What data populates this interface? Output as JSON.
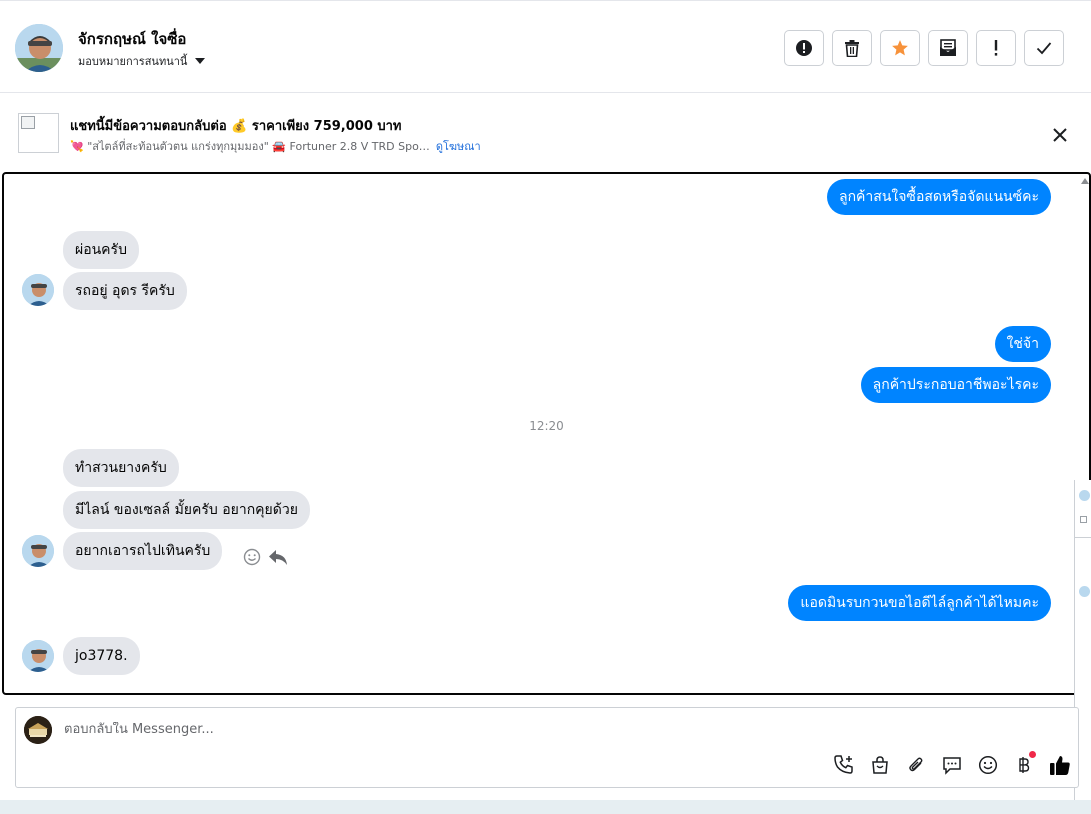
{
  "header": {
    "contact_name": "จักรกฤษณ์ ใจซื่อ",
    "assign_label": "มอบหมายการสนทนานี้",
    "actions": [
      {
        "name": "report-action",
        "icon": "exclamation-circle-icon"
      },
      {
        "name": "delete-action",
        "icon": "trash-icon"
      },
      {
        "name": "star-action",
        "icon": "star-icon",
        "color": "#f7923a"
      },
      {
        "name": "mark-unread-action",
        "icon": "envelope-icon"
      },
      {
        "name": "flag-action",
        "icon": "exclamation-icon"
      },
      {
        "name": "done-action",
        "icon": "check-icon"
      }
    ]
  },
  "ad": {
    "title": "แชทนี้มีข้อความตอบกลับต่อ 💰 ราคาเพียง 759,000 บาท",
    "subtitle": "💘 \"สไตล์ที่สะท้อนตัวตน แกร่งทุกมุมมอง\" 🚘 Fortuner 2.8 V TRD Spo…",
    "view_ad_link": "ดูโฆษณา"
  },
  "messages": [
    {
      "dir": "out",
      "text": "ลูกค้าสนใจซื้อสดหรือจัดแนนซ์คะ"
    },
    {
      "dir": "in",
      "text": "ผ่อนครับ"
    },
    {
      "dir": "in",
      "text": "รถอยู่ อุดร   รีครับ",
      "avatar": true
    },
    {
      "dir": "out",
      "text": "ใช่จ้า"
    },
    {
      "dir": "out",
      "text": "ลูกค้าประกอบอาชีพอะไรคะ"
    },
    {
      "dir": "time",
      "text": "12:20"
    },
    {
      "dir": "in",
      "text": "ทำสวนยางครับ"
    },
    {
      "dir": "in",
      "text": "มีไลน์ ของเซลล์  มั้ยครับ   อยากคุยด้วย"
    },
    {
      "dir": "in",
      "text": "อยากเอารถไปเทินครับ",
      "avatar": true,
      "reactions": true
    },
    {
      "dir": "out",
      "text": "แอดมินรบกวนขอไอดีไล์ลูกค้าได้ไหมคะ"
    },
    {
      "dir": "in",
      "text": "jo3778.",
      "avatar": true
    }
  ],
  "composer": {
    "placeholder": "ตอบกลับใน Messenger...",
    "tools": [
      "phone-plus-icon",
      "shopping-bag-icon",
      "paperclip-icon",
      "saved-reply-icon",
      "emoji-icon",
      "baht-payment-icon",
      "thumbs-up-icon"
    ]
  },
  "colors": {
    "outgoing_bubble": "#0084ff",
    "incoming_bubble": "#e4e6eb",
    "link": "#216fdb",
    "star": "#f7923a",
    "like": "#050505"
  }
}
